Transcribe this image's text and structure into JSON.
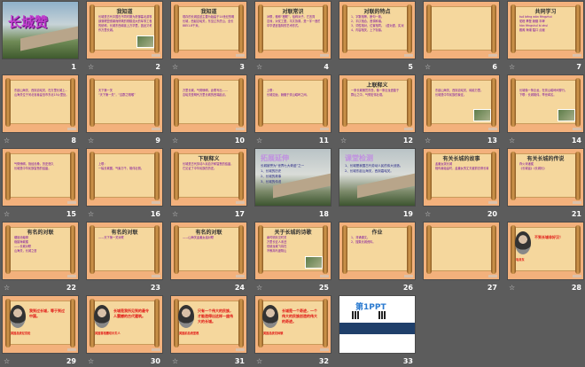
{
  "view": "slide-sorter",
  "slides": [
    {
      "num": "1",
      "type": "photo",
      "title": "长城赞",
      "star": false
    },
    {
      "num": "2",
      "type": "scroll",
      "title": "我知道",
      "lines": [
        "长城是古代中国在不同时期为抵御塞北游牧",
        "部落联盟侵袭而修筑的规模浩大的军事工程",
        "的统称。长城东西绵延上万华里，因此又称",
        "作万里长城。"
      ],
      "star": true
    },
    {
      "num": "3",
      "type": "scroll",
      "title": "我知道",
      "lines": [
        "现存的长城遗迹主要为始建于14世纪的明",
        "长城，西起嘉峪关，东至辽东虎山，全长",
        "8851.8千米。"
      ],
      "star": true
    },
    {
      "num": "4",
      "type": "scroll",
      "title": "对联常识",
      "lines": [
        "对联，雅称“楹联”，俗称对子。它言简",
        "意深，对仗工整，平仄协调，是一字一音的",
        "中华语言独特的艺术形式。"
      ],
      "star": true
    },
    {
      "num": "5",
      "type": "scroll",
      "title": "对联的特点",
      "lines": [
        "1、字数相等，断句一致。",
        "2、平仄相合，音调和谐。",
        "3、词性相对，位置相同。（虚对虚，实对实）",
        "4、内容相关，上下衔接。"
      ],
      "star": false
    },
    {
      "num": "6",
      "type": "scroll",
      "title": "",
      "lines": [],
      "star": true
    },
    {
      "num": "7",
      "type": "scroll",
      "title": "共同学习",
      "lines": [
        "tuó  bēng  wǎn  fēngzhuì",
        "驼峰  攀登  蜿蜒  丰碑",
        "hàn  fēngshuǐ  ài  zhuì",
        "殿阁  海潮  隘口  点缀"
      ],
      "star": true
    },
    {
      "num": "8",
      "type": "scroll",
      "title": "",
      "lines": [
        "东起山海关，西到嘉峪关，在万里长城上……",
        "山海关位于河北省秦皇岛市东北15公里处。"
      ],
      "star": true
    },
    {
      "num": "9",
      "type": "scroll",
      "title": "",
      "lines": [
        "天下第一关",
        "“天下第一关”，“边郡之咽喉”"
      ],
      "star": true
    },
    {
      "num": "10",
      "type": "scroll",
      "title": "",
      "lines": [
        "万里长城，气势磅礴，此联写出……",
        "嘉峪关是明代万里长城的西端起点。"
      ],
      "star": true
    },
    {
      "num": "11",
      "type": "scroll",
      "title": "",
      "lines": [
        "上联：",
        "长城如龙，蜿蜒于崇山峻岭之间。"
      ],
      "star": true
    },
    {
      "num": "12",
      "type": "scroll",
      "title": "上联释义",
      "lines": [
        "一条长城横贯东西，像一条巨龙盘旋于",
        "群山之中，气势宏伟壮观。"
      ],
      "star": true
    },
    {
      "num": "13",
      "type": "scroll",
      "title": "",
      "lines": [
        "东起山海关，西到嘉峪关，绵延万里。",
        "长城是中华民族的象征。"
      ],
      "star": true
    },
    {
      "num": "14",
      "type": "scroll",
      "title": "",
      "lines": [
        "长城像一条巨龙，在崇山峻岭间穿行。",
        "下联：长城雄伟，举世闻名。"
      ],
      "star": true
    },
    {
      "num": "15",
      "type": "scroll",
      "title": "",
      "lines": [
        "气势磅礴，饱经沧桑，历史悠久",
        "长城是中华民族智慧的结晶。"
      ],
      "star": true
    },
    {
      "num": "16",
      "type": "scroll",
      "title": "",
      "lines": [
        "上联：",
        "一幅长城图，气象万千，雄伟壮丽。"
      ],
      "star": true
    },
    {
      "num": "17",
      "type": "scroll",
      "title": "下联释义",
      "lines": [
        "长城是古代劳动人民血汗和智慧的结晶，",
        "它见证了中华民族的历史。"
      ],
      "star": true
    },
    {
      "num": "18",
      "type": "photo-mist",
      "title": "拓展延伸",
      "lines": [
        "长城被誉为“世界七大奇迹”之一",
        "1、长城的历史",
        "2、长城的故事",
        "3、长城的传说"
      ],
      "star": false
    },
    {
      "num": "19",
      "type": "photo-mist",
      "title": "课堂检测",
      "lines": [
        "1、长城是我国古代劳动人民的伟大创造。",
        "2、长城东起山海关，西到嘉峪关。"
      ],
      "star": false
    },
    {
      "num": "20",
      "type": "scroll",
      "title": "有关长城的故事",
      "lines": [
        "孟姜女哭长城",
        "相传秦始皇时，孟姜女的丈夫被抓去修长城……"
      ],
      "star": true
    },
    {
      "num": "21",
      "type": "scroll",
      "title": "有关长城的传说",
      "lines": [
        "烽火戏诸侯",
        "《长城谣》《长城长》"
      ],
      "star": false
    },
    {
      "num": "22",
      "type": "scroll",
      "title": "有名的对联",
      "lines": [
        "烟锁池塘柳",
        "炮镇海城楼",
        "——长城对联",
        "山海关，长城之首"
      ],
      "star": true
    },
    {
      "num": "23",
      "type": "scroll",
      "title": "有名的对联",
      "lines": [
        "——天下第一关对联"
      ],
      "star": false
    },
    {
      "num": "24",
      "type": "scroll",
      "title": "有名的对联",
      "lines": [
        "——山海关孟姜女庙对联"
      ],
      "star": false
    },
    {
      "num": "25",
      "type": "scroll",
      "title": "关于长城的诗歌",
      "lines": [
        "秦时明月汉时关",
        "万里长征人未还",
        "但使龙城飞将在",
        "不教胡马度阴山"
      ],
      "star": true
    },
    {
      "num": "26",
      "type": "scroll",
      "title": "作业",
      "lines": [
        "1、背诵课文。",
        "2、搜集长城资料。"
      ],
      "star": false
    },
    {
      "num": "27",
      "type": "scroll",
      "title": "",
      "lines": [],
      "star": false
    },
    {
      "num": "28",
      "type": "portrait",
      "title": "不到长城非好汉！",
      "lines": [
        "毛泽东"
      ],
      "star": true
    },
    {
      "num": "29",
      "type": "portrait",
      "title": "我到过长城，等于到过中国。",
      "lines": [
        "美国总统尼克松"
      ],
      "star": true
    },
    {
      "num": "30",
      "type": "portrait",
      "title": "长城是我所见到的最令人震撼的古代建筑。",
      "lines": [
        "英国首相撒切尔夫人"
      ],
      "star": true
    },
    {
      "num": "31",
      "type": "portrait",
      "title": "只有一个伟大的民族，才能造得出这样一座伟大的长城。",
      "lines": [
        "美国前总统里根"
      ],
      "star": true
    },
    {
      "num": "32",
      "type": "portrait",
      "title": "长城是一个奇迹，一个伟大的民族创造的伟大的奇迹。",
      "lines": [
        "美国总统克林顿"
      ],
      "star": true
    },
    {
      "num": "33",
      "type": "white",
      "title": "第1PPT",
      "lines": [],
      "star": false
    }
  ],
  "colors": {
    "background": "#5c5c5c",
    "slide_frame": "#f3b17c",
    "parchment": "#f5d79d",
    "text": "#7a0ca0"
  }
}
